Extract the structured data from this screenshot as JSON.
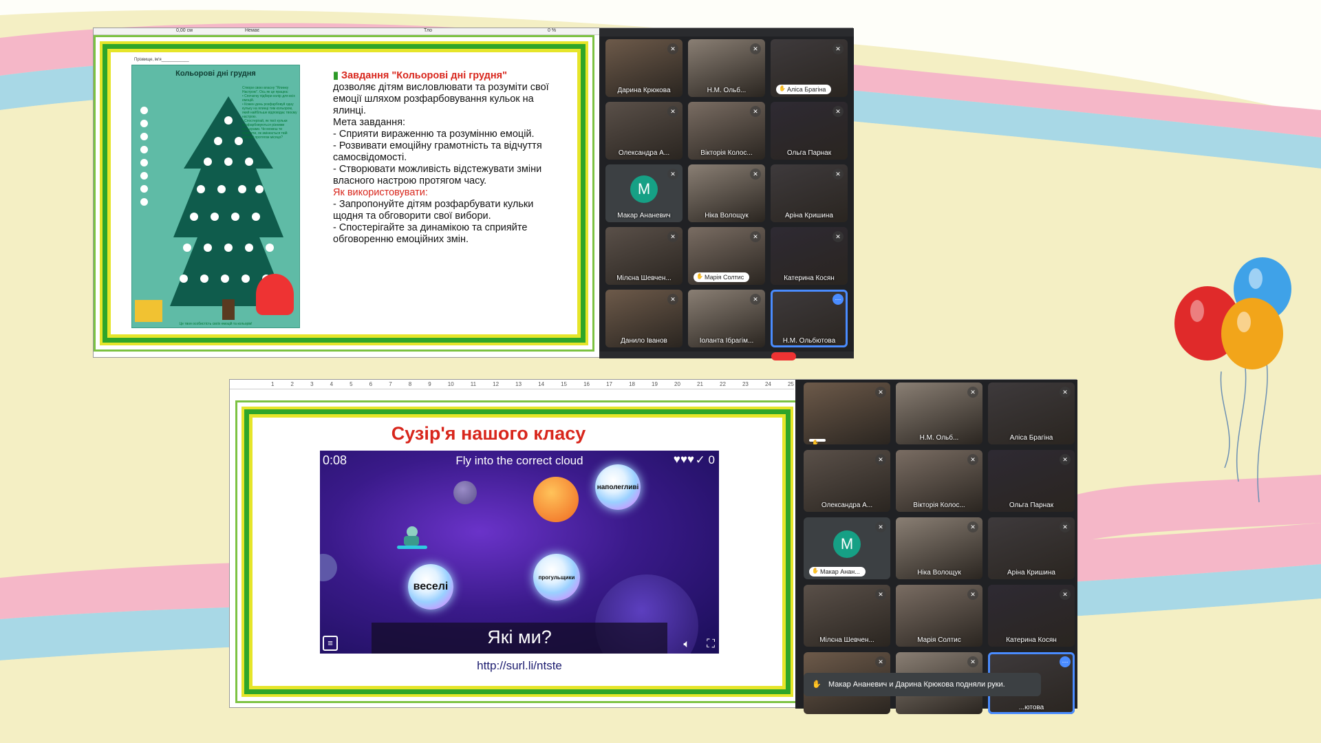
{
  "slide1": {
    "worksheet": {
      "name_line": "Прізвище, ім'я____________",
      "title": "Кольорові дні грудня",
      "instructions": "Створи свою власну \"Ялинку Настрою\". Ось як це працює:\n• Спочатку підбери колір для всіх емоцій.\n• Кожен день розфарбовуй одну кульку на ялинці тим кольором, який найбільше відповідає твоєму настрою.\n• Спостерігай, як твої кульки розфарбовуються різними кольорами. Чи можеш ти помітити, як змінюється твій настрій протягом місяця?",
      "footer": "Це твоя особистість своїх емоцій та кольорів!"
    },
    "title": "Завдання \"Кольорові дні грудня\"",
    "intro": "дозволяє дітям висловлювати та розуміти свої емоції шляхом розфарбовування кульок на ялинці.",
    "goal_label": "Мета завдання:",
    "goals": [
      "- Сприяти вираженню та розумінню емоцій.",
      "- Розвивати емоційну грамотність та відчуття самосвідомості.",
      "- Створювати можливість  відстежувати зміни власного настрою протягом часу."
    ],
    "usage_label": "Як використовувати:",
    "usage": [
      "- Запропонуйте дітям розфарбувати кульки щодня та обговорити свої вибори.",
      "- Спостерігайте за динамікою та сприяйте обговоренню емоційних змін."
    ],
    "toolbar": {
      "field1": "0,00 см",
      "field2": "Немає",
      "field3": "Тло",
      "zoom": "0 %"
    }
  },
  "meet1": {
    "tiles": [
      {
        "name": "Дарина Крюкова",
        "muted": true
      },
      {
        "name": "Н.М. Ольб...",
        "muted": true
      },
      {
        "name": "Аліса Брагіна",
        "muted": true,
        "hand": true
      },
      {
        "name": "Олександра А...",
        "muted": true
      },
      {
        "name": "Вікторія Колос...",
        "muted": true
      },
      {
        "name": "Ольга Парнак",
        "muted": true
      },
      {
        "name": "Макар Ананевич",
        "muted": true,
        "initial": "M"
      },
      {
        "name": "Ніка Волощук",
        "muted": true
      },
      {
        "name": "Аріна Кришина",
        "muted": true
      },
      {
        "name": "Мілєна Шевчен...",
        "muted": true
      },
      {
        "name": "Марія Солтис",
        "muted": true,
        "hand": true
      },
      {
        "name": "Катерина Косян",
        "muted": true
      },
      {
        "name": "Данило Іванов",
        "muted": true
      },
      {
        "name": "Іоланта Ібрагім...",
        "muted": true
      },
      {
        "name": "Н.М. Ольбютова",
        "muted": false,
        "speaking": true
      }
    ]
  },
  "slide2": {
    "title": "Сузір'я нашого класу",
    "link": "http://surl.li/ntste",
    "ruler_numbers": [
      "1",
      "2",
      "3",
      "4",
      "5",
      "6",
      "7",
      "8",
      "9",
      "10",
      "11",
      "12",
      "13",
      "14",
      "15",
      "16",
      "17",
      "18",
      "19",
      "20",
      "21",
      "22",
      "23",
      "24",
      "25"
    ],
    "game": {
      "timer": "0:08",
      "instruction": "Fly into the correct cloud",
      "score": "0",
      "question": "Які ми?",
      "bubbles": [
        "наполегливі",
        "веселі",
        "прогульщики"
      ]
    }
  },
  "meet2": {
    "tiles": [
      {
        "name": "",
        "muted": true,
        "hand": true
      },
      {
        "name": "Н.М. Ольб...",
        "muted": true
      },
      {
        "name": "Аліса Брагіна",
        "muted": true
      },
      {
        "name": "Олександра А...",
        "muted": true
      },
      {
        "name": "Вікторія Колос...",
        "muted": true
      },
      {
        "name": "Ольга Парнак",
        "muted": true
      },
      {
        "name": "Макар Анан...",
        "muted": true,
        "initial": "M",
        "hand": true
      },
      {
        "name": "Ніка Волощук",
        "muted": true
      },
      {
        "name": "Аріна Кришина",
        "muted": true
      },
      {
        "name": "Мілєна Шевчен...",
        "muted": true
      },
      {
        "name": "Марія Солтис",
        "muted": true
      },
      {
        "name": "Катерина Косян",
        "muted": true
      },
      {
        "name": "",
        "muted": true
      },
      {
        "name": "",
        "muted": true
      },
      {
        "name": "...ютова",
        "muted": false,
        "speaking": true
      }
    ],
    "notification": "Макар Ананевич и Дарина Крюкова подняли руки."
  },
  "colors": {
    "slide_title_red": "#d8261c",
    "border_green": "#2fa52a",
    "meet_bg": "#202124",
    "highlight_blue": "#4a8cff"
  }
}
